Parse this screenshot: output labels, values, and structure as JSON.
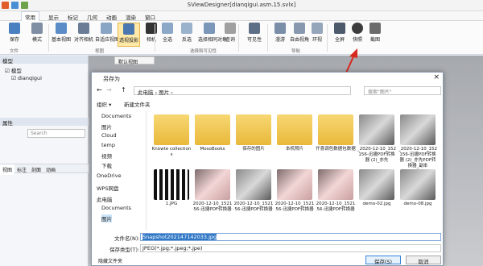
{
  "window": {
    "title": "SViewDesigner[dianqigui.asm.15.svlx]"
  },
  "menu": [
    "常用",
    "显示",
    "标记",
    "几何",
    "动画",
    "渲染",
    "窗口"
  ],
  "ribbon": {
    "buttons": [
      {
        "label": "保存"
      },
      {
        "label": "模式"
      },
      {
        "label": "基本视图"
      },
      {
        "label": "对齐相机"
      },
      {
        "label": "自适应视图"
      },
      {
        "label": "透视投影"
      },
      {
        "label": "相机"
      },
      {
        "label": "全选"
      },
      {
        "label": "反选"
      },
      {
        "label": "选择相同对象"
      },
      {
        "label": "查询"
      },
      {
        "label": "可见性"
      },
      {
        "label": "漫游"
      },
      {
        "label": "自由视角"
      },
      {
        "label": "环视"
      },
      {
        "label": "全屏"
      },
      {
        "label": "快照"
      },
      {
        "label": "截图"
      }
    ],
    "groups": [
      "文件",
      "视图",
      "选择和可见性",
      "导航"
    ]
  },
  "left_panel": {
    "header": "模型",
    "tree": [
      "模型",
      "dianqigui"
    ],
    "tabs": [
      "视图",
      "标注",
      "剖面",
      "动画"
    ],
    "props_header": "属性",
    "search_placeholder": "Search"
  },
  "viewport": {
    "tab": "默认视图"
  },
  "dialog": {
    "title": "另存为",
    "path": "此电脑 › 图片 ›",
    "search_placeholder": "搜索\"图片\"",
    "toolbar": {
      "organize": "组织 ▾",
      "new_folder": "新建文件夹"
    },
    "nav": [
      "Documents",
      "图片",
      "Cloud",
      "temp",
      "视频",
      "下载",
      "OneDrive",
      "WPS网盘",
      "此电脑",
      "Documents",
      "图片"
    ],
    "files": [
      {
        "name": "Knowte collections",
        "kind": "folder"
      },
      {
        "name": "MosoBooks",
        "kind": "folder"
      },
      {
        "name": "保存的图片",
        "kind": "folder"
      },
      {
        "name": "本机照片",
        "kind": "folder"
      },
      {
        "name": "仟喜调色数据包数据",
        "kind": "folder"
      },
      {
        "name": "_2020-12-10_152156-迅捷PDF转换器 (2)_亦先",
        "kind": "pic"
      },
      {
        "name": "_2020-12-10_152156-迅捷PDF转换器 (2)_亦先PDF转换器_副本",
        "kind": "pic"
      },
      {
        "name": "1.JPG",
        "kind": "qr"
      },
      {
        "name": "2020-12-10_152156-迅捷PDF转换器",
        "kind": "pinkpic"
      },
      {
        "name": "2020-12-10_152156-迅捷PDF转换器",
        "kind": "pic"
      },
      {
        "name": "2020-12-10_152156-迅捷PDF转换器",
        "kind": "pinkpic"
      },
      {
        "name": "2020-12-10_152156-迅捷PDF转换器",
        "kind": "pinkpic"
      },
      {
        "name": "demo-02.jpg",
        "kind": "pic"
      },
      {
        "name": "demo-08.jpg",
        "kind": "pic"
      }
    ],
    "filename_label": "文件名(N):",
    "filename": "Snapshot202147142033.jpg",
    "filetype_label": "保存类型(T):",
    "filetype": "JPEG(*.jpg;*.jpeg;*.jpe)",
    "hide_folders": "隐藏文件夹",
    "save": "保存(S)",
    "cancel": "取消"
  }
}
